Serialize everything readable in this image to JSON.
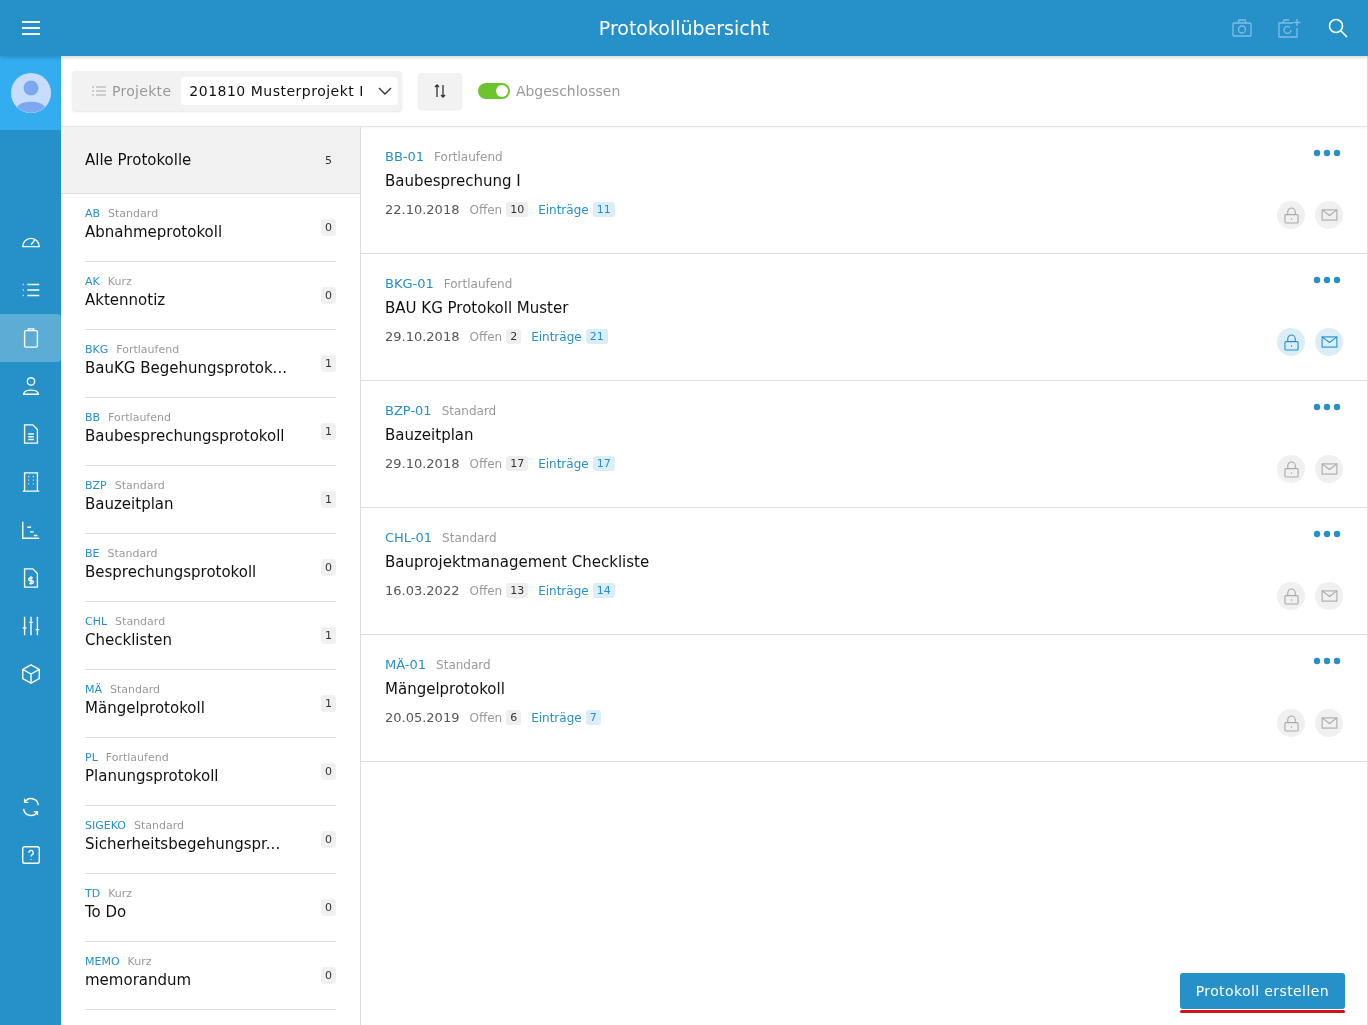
{
  "header": {
    "title": "Protokollübersicht"
  },
  "rail": {
    "items": [
      {
        "kind": "gauge",
        "selected": false
      },
      {
        "kind": "list",
        "selected": false
      },
      {
        "kind": "clipboard",
        "selected": true
      },
      {
        "kind": "person",
        "selected": false
      },
      {
        "kind": "document",
        "selected": false
      },
      {
        "kind": "building",
        "selected": false
      },
      {
        "kind": "chart",
        "selected": false
      },
      {
        "kind": "invoice",
        "selected": false
      },
      {
        "kind": "sliders",
        "selected": false
      },
      {
        "kind": "cube",
        "selected": false
      }
    ],
    "bottom_items": [
      {
        "kind": "sync"
      },
      {
        "kind": "help"
      }
    ]
  },
  "toolbar": {
    "projects_label": "Projekte",
    "project": "201810 Musterprojekt I",
    "closed_toggle": {
      "label": "Abgeschlossen",
      "on": true
    }
  },
  "categories": {
    "all": {
      "label": "Alle Protokolle",
      "count": "5",
      "selected": true
    },
    "items": [
      {
        "code": "AB",
        "type": "Standard",
        "name": "Abnahmeprotokoll",
        "count": "0",
        "selected": false
      },
      {
        "code": "AK",
        "type": "Kurz",
        "name": "Aktennotiz",
        "count": "0",
        "selected": false
      },
      {
        "code": "BKG",
        "type": "Fortlaufend",
        "name": "BauKG Begehungsprotok...",
        "count": "1",
        "selected": false
      },
      {
        "code": "BB",
        "type": "Fortlaufend",
        "name": "Baubesprechungsprotokoll",
        "count": "1",
        "selected": false
      },
      {
        "code": "BZP",
        "type": "Standard",
        "name": "Bauzeitplan",
        "count": "1",
        "selected": false
      },
      {
        "code": "BE",
        "type": "Standard",
        "name": "Besprechungsprotokoll",
        "count": "0",
        "selected": false
      },
      {
        "code": "CHL",
        "type": "Standard",
        "name": "Checklisten",
        "count": "1",
        "selected": false
      },
      {
        "code": "MÄ",
        "type": "Standard",
        "name": "Mängelprotokoll",
        "count": "1",
        "selected": false
      },
      {
        "code": "PL",
        "type": "Fortlaufend",
        "name": "Planungsprotokoll",
        "count": "0",
        "selected": false
      },
      {
        "code": "SIGEKO",
        "type": "Standard",
        "name": "Sicherheitsbegehungspr...",
        "count": "0",
        "selected": false
      },
      {
        "code": "TD",
        "type": "Kurz",
        "name": "To Do",
        "count": "0",
        "selected": false
      },
      {
        "code": "MEMO",
        "type": "Kurz",
        "name": "memorandum",
        "count": "0",
        "selected": false
      }
    ]
  },
  "protocols": [
    {
      "id": "BB-01",
      "type": "Fortlaufend",
      "title": "Baubesprechung I",
      "date": "22.10.2018",
      "open_label": "Offen",
      "open": "10",
      "entries_label": "Einträge",
      "entries": "11",
      "active": false
    },
    {
      "id": "BKG-01",
      "type": "Fortlaufend",
      "title": "BAU KG Protokoll Muster",
      "date": "29.10.2018",
      "open_label": "Offen",
      "open": "2",
      "entries_label": "Einträge",
      "entries": "21",
      "active": true
    },
    {
      "id": "BZP-01",
      "type": "Standard",
      "title": "Bauzeitplan",
      "date": "29.10.2018",
      "open_label": "Offen",
      "open": "17",
      "entries_label": "Einträge",
      "entries": "17",
      "active": false
    },
    {
      "id": "CHL-01",
      "type": "Standard",
      "title": "Bauprojektmanagement Checkliste",
      "date": "16.03.2022",
      "open_label": "Offen",
      "open": "13",
      "entries_label": "Einträge",
      "entries": "14",
      "active": false
    },
    {
      "id": "MÄ-01",
      "type": "Standard",
      "title": "Mängelprotokoll",
      "date": "20.05.2019",
      "open_label": "Offen",
      "open": "6",
      "entries_label": "Einträge",
      "entries": "7",
      "active": false
    }
  ],
  "create_button": "Protokoll erstellen"
}
